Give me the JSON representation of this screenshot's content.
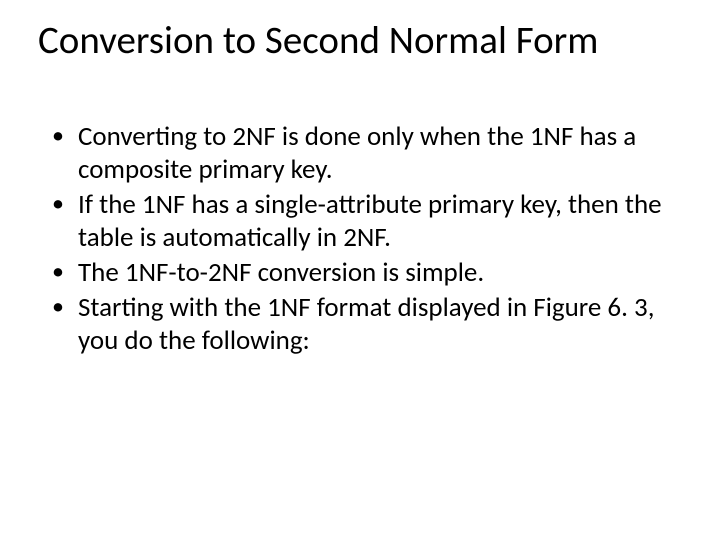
{
  "slide": {
    "title": "Conversion to Second Normal Form",
    "bullets": [
      "Converting to 2NF is done only when the 1NF has a composite primary key.",
      "If the 1NF has a single-attribute primary key, then the table is automatically in 2NF.",
      "The 1NF-to-2NF conversion is simple.",
      "Starting with the 1NF format displayed in Figure 6. 3, you do the following:"
    ]
  }
}
